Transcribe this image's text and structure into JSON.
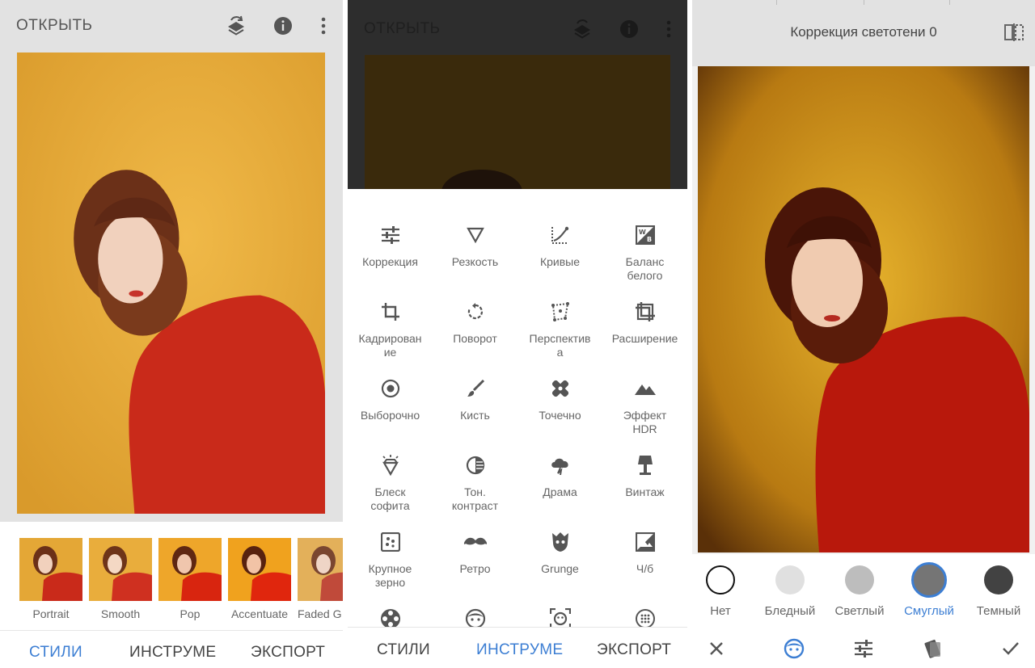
{
  "panel1": {
    "title": "ОТКРЫТЬ",
    "styles": [
      {
        "label": "Portrait"
      },
      {
        "label": "Smooth"
      },
      {
        "label": "Pop"
      },
      {
        "label": "Accentuate"
      },
      {
        "label": "Faded G"
      }
    ],
    "nav": {
      "styles": "СТИЛИ",
      "tools": "ИНСТРУМЕ",
      "export": "ЭКСПОРТ"
    }
  },
  "panel2": {
    "title": "ОТКРЫТЬ",
    "tools": [
      {
        "label": "Коррекция",
        "icon": "tune-icon"
      },
      {
        "label": "Резкость",
        "icon": "triangle-icon"
      },
      {
        "label": "Кривые",
        "icon": "curves-icon"
      },
      {
        "label": "Баланс белого",
        "icon": "white-balance-icon"
      },
      {
        "label": "Кадрирование",
        "icon": "crop-icon"
      },
      {
        "label": "Поворот",
        "icon": "rotate-icon"
      },
      {
        "label": "Перспектива",
        "icon": "perspective-icon"
      },
      {
        "label": "Расширение",
        "icon": "expand-icon"
      },
      {
        "label": "Выборочно",
        "icon": "target-icon"
      },
      {
        "label": "Кисть",
        "icon": "brush-icon"
      },
      {
        "label": "Точечно",
        "icon": "healing-icon"
      },
      {
        "label": "Эффект HDR",
        "icon": "mountain-icon"
      },
      {
        "label": "Блеск софита",
        "icon": "diamond-icon"
      },
      {
        "label": "Тон. контраст",
        "icon": "tonal-icon"
      },
      {
        "label": "Драма",
        "icon": "cloud-icon"
      },
      {
        "label": "Винтаж",
        "icon": "lamp-icon"
      },
      {
        "label": "Крупное зерно",
        "icon": "grain-icon"
      },
      {
        "label": "Ретро",
        "icon": "mustache-icon"
      },
      {
        "label": "Grunge",
        "icon": "grunge-icon"
      },
      {
        "label": "Ч/б",
        "icon": "bw-icon"
      },
      {
        "label": "",
        "icon": "film-icon"
      },
      {
        "label": "",
        "icon": "face-icon"
      },
      {
        "label": "",
        "icon": "face-frame-icon"
      },
      {
        "label": "",
        "icon": "dots-circle-icon"
      }
    ],
    "nav": {
      "styles": "СТИЛИ",
      "tools": "ИНСТРУМЕ",
      "export": "ЭКСПОРТ"
    }
  },
  "panel3": {
    "title": "Коррекция светотени 0",
    "swatches": [
      {
        "label": "Нет",
        "color": "#ffffff"
      },
      {
        "label": "Бледный",
        "color": "#e0e0e0"
      },
      {
        "label": "Светлый",
        "color": "#bdbdbd"
      },
      {
        "label": "Смуглый",
        "color": "#757575"
      },
      {
        "label": "Темный",
        "color": "#424242"
      }
    ],
    "selected_swatch": "Смуглый"
  },
  "colors": {
    "accent": "#3c7ed3",
    "photo_bg": "#e7a833",
    "sweater": "#c92a1a",
    "hair": "#6b3018"
  }
}
